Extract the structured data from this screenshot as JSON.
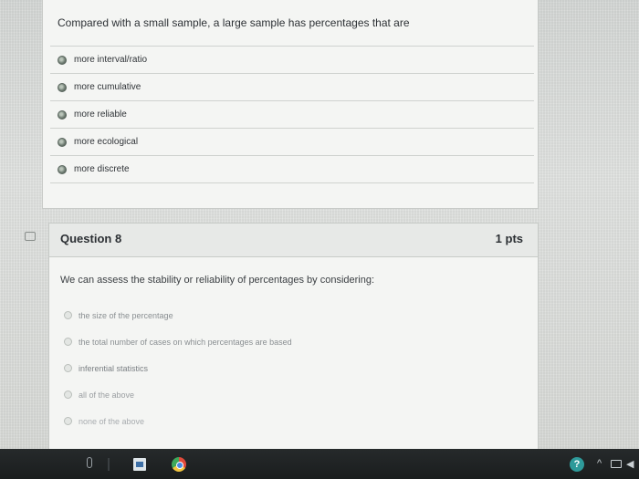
{
  "question7": {
    "prompt": "Compared with a small sample, a large sample has percentages that are",
    "answers": [
      "more interval/ratio",
      "more cumulative",
      "more reliable",
      "more ecological",
      "more discrete"
    ]
  },
  "question8": {
    "title": "Question 8",
    "points": "1 pts",
    "prompt": "We can assess the stability or reliability of percentages by considering:",
    "answers": [
      "the size of the percentage",
      "the total number of cases on which percentages are based",
      "inferential statistics",
      "all of the above",
      "none of the above"
    ]
  },
  "taskbar": {
    "help_glyph": "?",
    "caret_glyph": "^",
    "volume_glyph": "◀"
  }
}
